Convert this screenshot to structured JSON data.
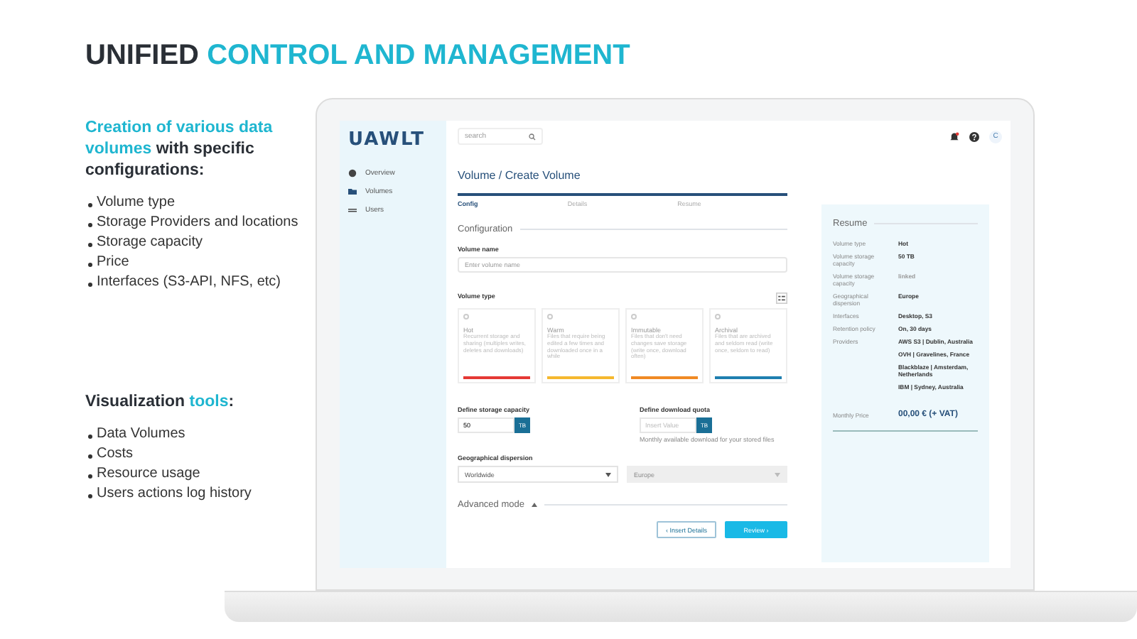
{
  "slide_title": [
    {
      "text": "UNIFIED ",
      "accent": false
    },
    {
      "text": "CONTROL AND MANAGEMENT",
      "accent": true
    }
  ],
  "sections": [
    {
      "heading": [
        {
          "text": "Creation of various data volumes",
          "accent": true
        },
        {
          "text": " with specific configurations:",
          "accent": false
        }
      ],
      "items": [
        "Volume type",
        "Storage Providers and locations",
        "Storage capacity",
        "Price",
        "Interfaces  (S3-API, NFS, etc)"
      ]
    },
    {
      "heading": [
        {
          "text": "Visualization ",
          "accent": false
        },
        {
          "text": "tools",
          "accent": true
        },
        {
          "text": ":",
          "accent": false
        }
      ],
      "items": [
        "Data Volumes",
        "Costs",
        "Resource usage",
        "Users actions log history"
      ]
    }
  ],
  "app": {
    "logo": "UAWLT",
    "sidebar": [
      {
        "label": "Overview"
      },
      {
        "label": "Volumes"
      },
      {
        "label": "Users"
      }
    ],
    "search": {
      "placeholder": "search"
    },
    "avatar": "C",
    "page_title": "Volume / Create Volume",
    "steps": [
      {
        "label": "Config",
        "selected": true
      },
      {
        "label": "Details",
        "selected": false
      },
      {
        "label": "Resume",
        "selected": false
      }
    ],
    "section_title": "Configuration",
    "volume_name": {
      "label": "Volume name",
      "placeholder": "Enter volume name"
    },
    "volume_type": {
      "label": "Volume type",
      "cards": [
        {
          "name": "Hot",
          "description": "Recurrent storage and sharing (multiples writes, deletes and downloads)",
          "color": "#e53935"
        },
        {
          "name": "Warm",
          "description": "Files that require being edited a few times and downloaded once in a while",
          "color": "#f5b82e"
        },
        {
          "name": "Immutable",
          "description": "Files that don't need changes save storage (write once, download often)",
          "color": "#f08a24"
        },
        {
          "name": "Archival",
          "description": "Files that are archived and seldom read (write once, seldom to read)",
          "color": "#1f7fb0"
        }
      ]
    },
    "capacity": {
      "label": "Define storage capacity",
      "value": "50",
      "unit": "TB"
    },
    "quota": {
      "label": "Define download quota",
      "placeholder": "Insert Value",
      "unit": "TB",
      "hint": "Monthly available download for your stored files"
    },
    "dispersion": {
      "label": "Geographical dispersion",
      "value": "Worldwide",
      "second_placeholder": "Europe"
    },
    "advanced": "Advanced mode",
    "buttons": [
      {
        "label": "‹ Insert Details",
        "kind": "outline"
      },
      {
        "label": "Review ›",
        "kind": "primary"
      }
    ],
    "resume": {
      "title": "Resume",
      "rows": [
        {
          "label": "Volume type",
          "values": [
            "Hot"
          ],
          "faded": false
        },
        {
          "label": "Volume storage capacity",
          "values": [
            "50 TB"
          ],
          "faded": false
        },
        {
          "label": "Volume storage capacity",
          "values": [
            "linked"
          ],
          "faded": true
        },
        {
          "label": "Geographical dispersion",
          "values": [
            "Europe"
          ],
          "faded": false
        },
        {
          "label": "Interfaces",
          "values": [
            "Desktop, S3"
          ],
          "faded": false
        },
        {
          "label": "Retention policy",
          "values": [
            "On, 30 days"
          ],
          "faded": false
        },
        {
          "label": "Providers",
          "values": [
            "AWS S3 | Dublin, Australia",
            "OVH | Gravelines, France",
            "Blackblaze | Amsterdam, Netherlands",
            "IBM | Sydney, Australia"
          ],
          "faded": false
        }
      ],
      "price_label": "Monthly Price",
      "price": "00,00 € (+ VAT)"
    }
  }
}
